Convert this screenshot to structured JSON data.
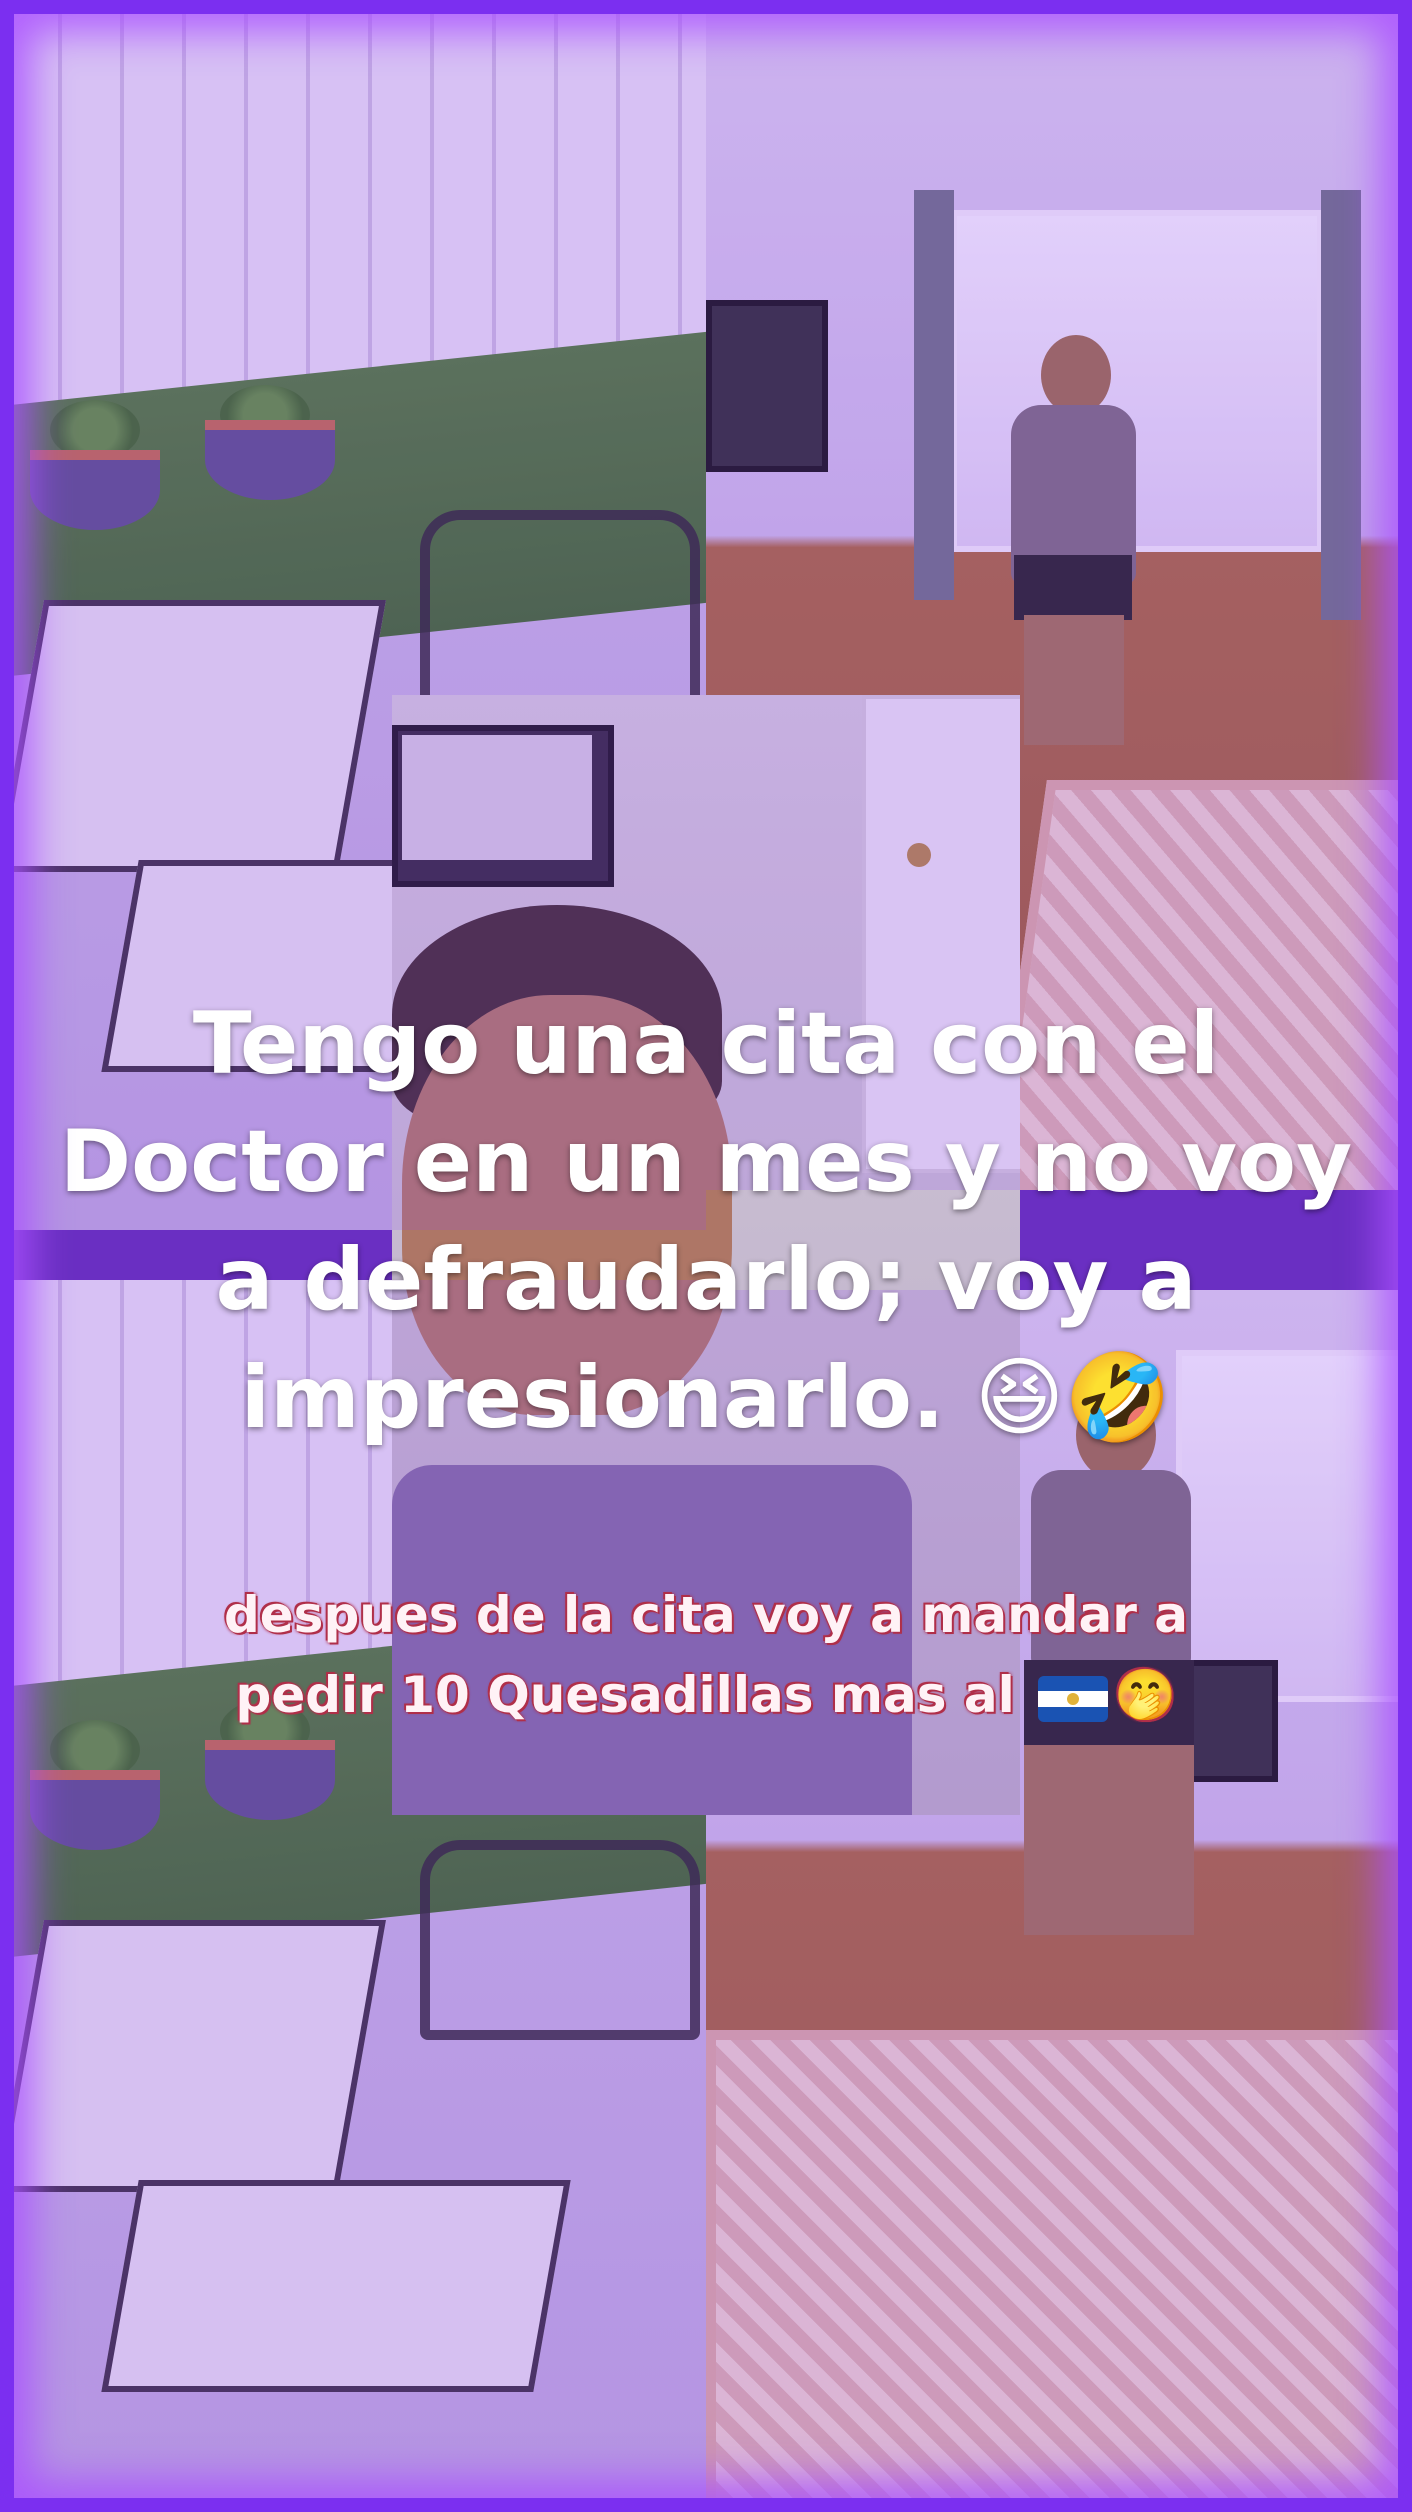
{
  "caption": {
    "main_lines": [
      "Tengo una cita con el",
      "Doctor en un mes y no voy",
      "a defraudarlo; voy a",
      "impresionarlo. 😆🤣"
    ],
    "sub_line_1": "despues de la cita voy a mandar a",
    "sub_line_2": "pedir 10 Quesadillas mas al",
    "sub_line_2_emoji": "🤭"
  },
  "colors": {
    "frame": "#7b2ff0",
    "tint": "#9646ff",
    "caption_outline": "#b0304a"
  },
  "icons": {
    "flag": "el-salvador-flag-icon",
    "emoji_laugh": "grinning-squinting-face",
    "emoji_rofl": "rolling-on-floor-laughing",
    "emoji_hand": "face-with-hand-over-mouth"
  }
}
